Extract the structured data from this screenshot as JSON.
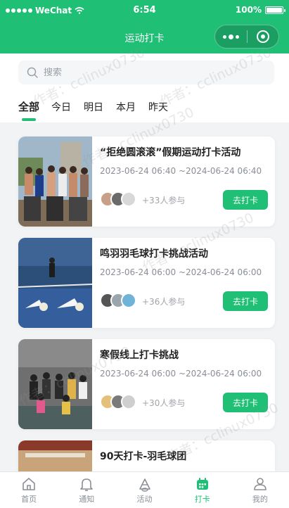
{
  "status_bar": {
    "carrier": "WeChat",
    "time": "6:54",
    "battery": "100%",
    "battery_level": 1.0
  },
  "nav": {
    "title": "运动打卡"
  },
  "search": {
    "placeholder": "搜索"
  },
  "tabs": [
    {
      "label": "全部",
      "active": true
    },
    {
      "label": "今日",
      "active": false
    },
    {
      "label": "明日",
      "active": false
    },
    {
      "label": "本月",
      "active": false
    },
    {
      "label": "昨天",
      "active": false
    }
  ],
  "activities": [
    {
      "title": "“拒绝圆滚滚”假期运动打卡活动",
      "date": "2023-06-24 06:40 ~2024-06-24 06:40",
      "participants": "+33人参与",
      "button": "去打卡"
    },
    {
      "title": "鸣羽羽毛球打卡挑战活动",
      "date": "2023-06-24 06:00 ~2024-06-24 06:00",
      "participants": "+36人参与",
      "button": "去打卡"
    },
    {
      "title": "寒假线上打卡挑战",
      "date": "2023-06-24 06:00 ~2024-06-24 06:00",
      "participants": "+30人参与",
      "button": "去打卡"
    },
    {
      "title": "90天打卡-羽毛球团",
      "date": "",
      "participants": "",
      "button": ""
    }
  ],
  "watermark": "作者：cclinux0730",
  "tab_bar": [
    {
      "label": "首页",
      "icon": "home-icon",
      "active": false
    },
    {
      "label": "通知",
      "icon": "bell-icon",
      "active": false
    },
    {
      "label": "活动",
      "icon": "shuttlecock-icon",
      "active": false
    },
    {
      "label": "打卡",
      "icon": "calendar-icon",
      "active": true
    },
    {
      "label": "我的",
      "icon": "user-icon",
      "active": false
    }
  ],
  "colors": {
    "primary": "#1fbf76",
    "background": "#f2f3f5",
    "text": "#222222",
    "muted": "#8a8f96"
  }
}
